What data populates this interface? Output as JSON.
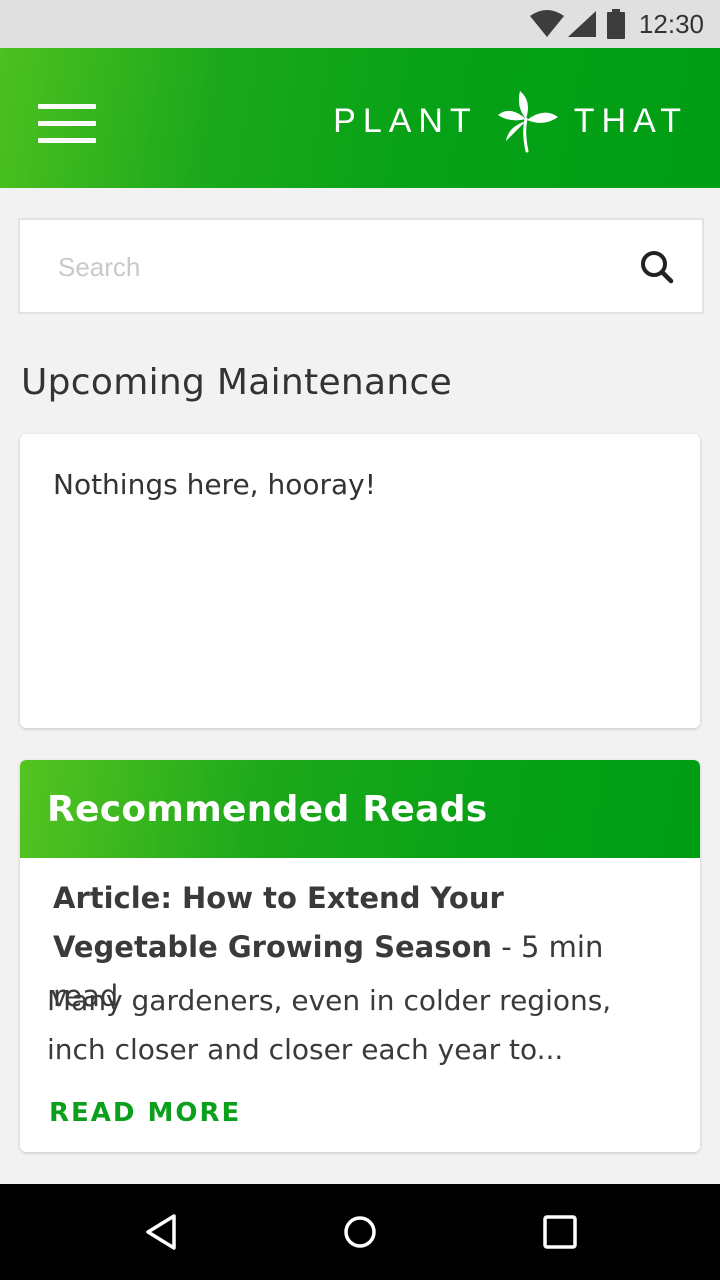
{
  "status_bar": {
    "time": "12:30",
    "icons": [
      "wifi-icon",
      "signal-icon",
      "battery-icon"
    ]
  },
  "app_bar": {
    "menu_icon": "hamburger-menu-icon",
    "brand_left": "PLANT",
    "brand_right": "THAT",
    "logo_icon": "sprout-icon",
    "color_start": "#4cc11f",
    "color_end": "#009e15"
  },
  "search": {
    "value": "",
    "placeholder": "Search",
    "icon": "search-icon"
  },
  "maintenance": {
    "title": "Upcoming Maintenance",
    "empty_text": "Nothings here, hooray!"
  },
  "recommended": {
    "title": "Recommended Reads",
    "article": {
      "title": "Article: How to Extend Your Vegetable Growing Season",
      "read_time": "- 5 min read",
      "summary": "Many gardeners, even in colder regions, inch closer and closer each year to...",
      "cta": "READ MORE"
    },
    "accent_color": "#0aa01c"
  },
  "nav_bar": {
    "icons": [
      "back-icon",
      "home-icon",
      "recents-icon"
    ]
  }
}
